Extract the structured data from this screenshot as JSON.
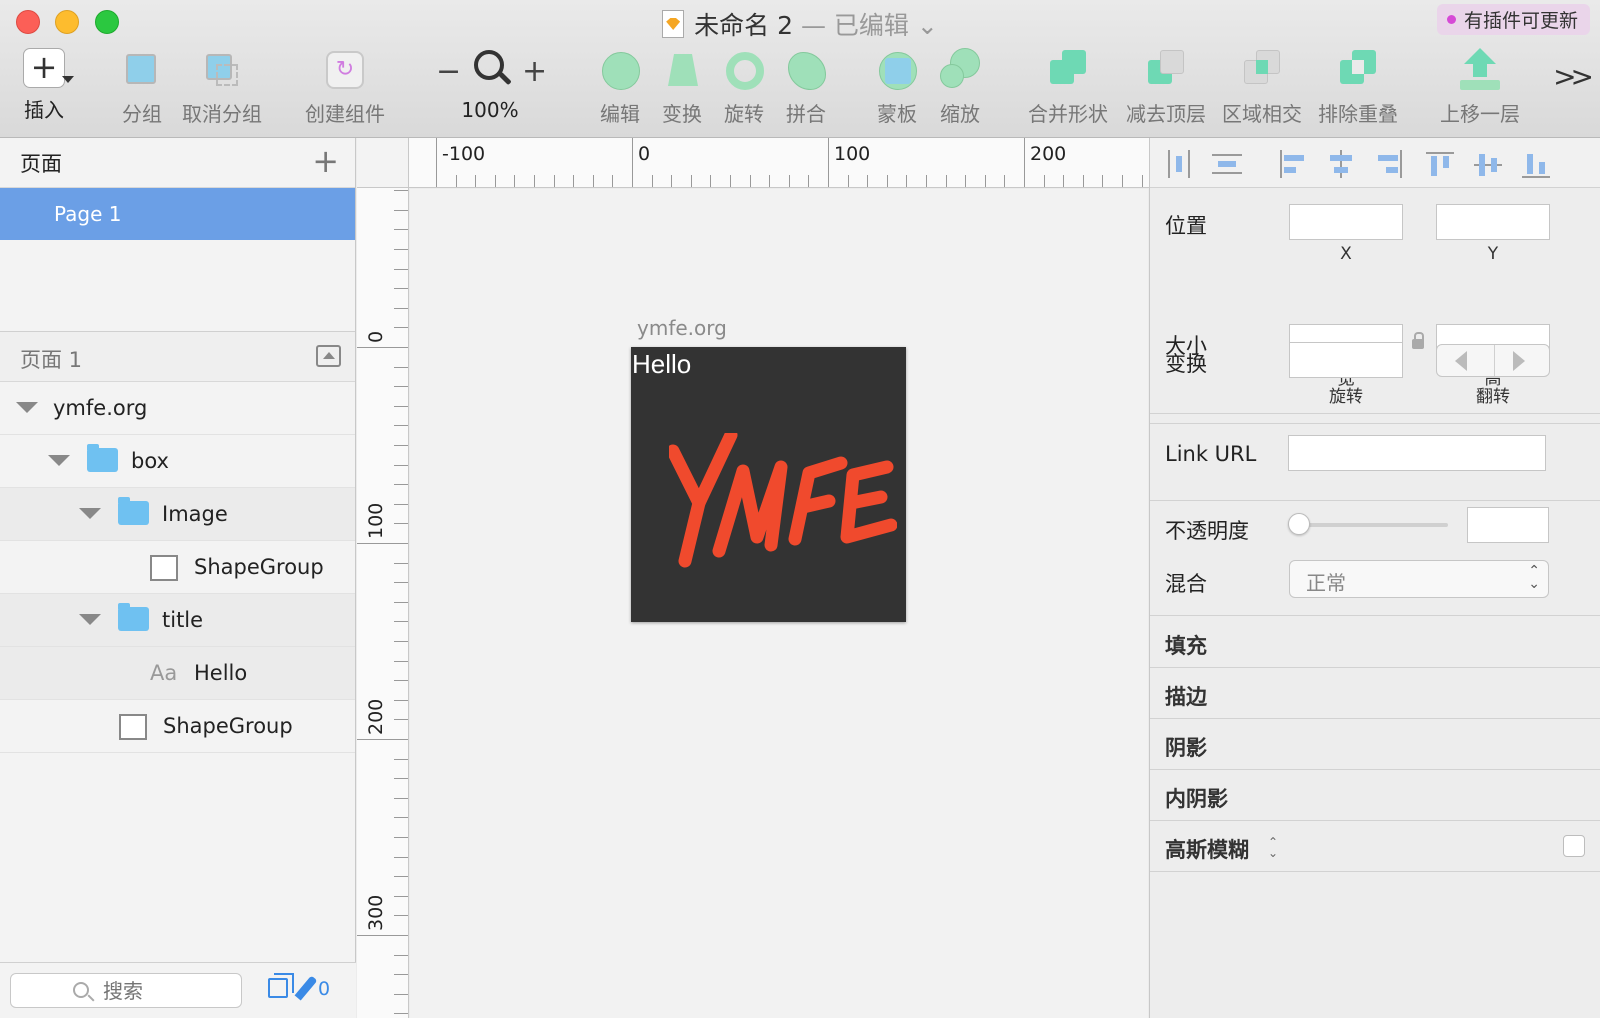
{
  "window": {
    "doc_title": "未命名 2",
    "edited_label": "— 已编辑",
    "plugin_badge": "有插件可更新"
  },
  "toolbar": {
    "insert": "插入",
    "group": "分组",
    "ungroup": "取消分组",
    "create_symbol": "创建组件",
    "zoom": "100%",
    "zoom_minus": "−",
    "zoom_plus": "+",
    "edit": "编辑",
    "transform": "变换",
    "rotate": "旋转",
    "flatten": "拼合",
    "mask": "蒙板",
    "scale": "缩放",
    "union": "合并形状",
    "subtract": "减去顶层",
    "intersect": "区域相交",
    "difference": "排除重叠",
    "forward": "上移一层",
    "more": ">>"
  },
  "sidebar": {
    "pages_title": "页面",
    "add_page": "+",
    "pages": [
      "Page 1"
    ],
    "layer_section_title": "页面 1",
    "layers": [
      {
        "name": "ymfe.org",
        "kind": "artboard"
      },
      {
        "name": "box",
        "kind": "group"
      },
      {
        "name": "Image",
        "kind": "group"
      },
      {
        "name": "ShapeGroup",
        "kind": "shape"
      },
      {
        "name": "title",
        "kind": "group"
      },
      {
        "name": "Hello",
        "kind": "text",
        "prefix": "Aa"
      },
      {
        "name": "ShapeGroup",
        "kind": "shape"
      }
    ],
    "search_placeholder": "搜索",
    "edited_count": "0"
  },
  "canvas": {
    "ruler_h_labels": [
      "-100",
      "0",
      "100",
      "200"
    ],
    "ruler_v_labels": [
      "0",
      "100",
      "200",
      "300"
    ],
    "artboard_name": "ymfe.org",
    "artboard_text": "Hello",
    "logo_text": "YMFE",
    "logo_color": "#f04a2d",
    "artboard_bg": "#333333"
  },
  "inspector": {
    "position_label": "位置",
    "x_label": "X",
    "y_label": "Y",
    "size_label": "大小",
    "width_label": "宽",
    "height_label": "高",
    "transform_label": "变换",
    "rotate_label": "旋转",
    "flip_label": "翻转",
    "link_label": "Link URL",
    "opacity_label": "不透明度",
    "blend_label": "混合",
    "blend_value": "正常",
    "fill": "填充",
    "border": "描边",
    "shadow": "阴影",
    "inner_shadow": "内阴影",
    "blur": "高斯模糊"
  },
  "colors": {
    "selection": "#6b9fe6",
    "folder": "#6fc1f1",
    "accent": "#3a8ae6"
  }
}
